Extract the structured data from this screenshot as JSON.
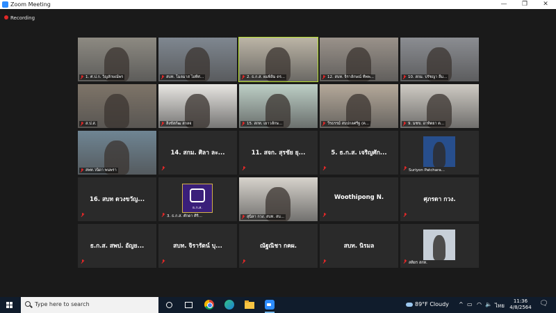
{
  "window": {
    "title": "Zoom Meeting"
  },
  "window_controls": {
    "minimize": "—",
    "maximize": "❐",
    "close": "✕"
  },
  "recording": {
    "label": "Recording"
  },
  "tiles": [
    {
      "name": "1. ศ.ป.ก. วิญลักษณ์พร",
      "kind": "video",
      "bg": "#8d8a82"
    },
    {
      "name": "สบท. โมลมาส ไอทีศ...",
      "kind": "video",
      "bg": "#7f8790"
    },
    {
      "name": "2. ธ.ก.ส. ผมพิลิม ดร...",
      "kind": "video",
      "bg": "#bcb5a6",
      "active": true
    },
    {
      "name": "12. สบท. จิราลักษณ์ ทีพพ...",
      "kind": "video",
      "bg": "#9a928a"
    },
    {
      "name": "10. สกม. ปรัชญา ลิ้ม...",
      "kind": "video",
      "bg": "#8b8d92"
    },
    {
      "name": "ส.ป.ส.",
      "kind": "video",
      "bg": "#7e7468"
    },
    {
      "name": "สิงขัสกัฒ สกลจ",
      "kind": "video",
      "bg": "#e8e6e2"
    },
    {
      "name": "15. สกท. เยาวลักษ...",
      "kind": "video",
      "bg": "#bdcfc6"
    },
    {
      "name": "วีรธรรม์ สบปกลศรีฐ (ค...",
      "kind": "video",
      "bg": "#b5a99a"
    },
    {
      "name": "9. มชข. อาทิตยา ต...",
      "kind": "video",
      "bg": "#cfcbc4"
    },
    {
      "name": "สพท.วนิดา พนพรา",
      "kind": "video",
      "bg": "#6f8593"
    },
    {
      "name": "14. สกม. ศิลา ละ...",
      "kind": "text"
    },
    {
      "name": "11. สจก. สุรชัย ยุ...",
      "kind": "text"
    },
    {
      "name": "5. ธ.ก.ส. เจริญศัก...",
      "kind": "text"
    },
    {
      "name": "Suriyon Patchara...",
      "kind": "avatar",
      "bg": "#274e8c"
    },
    {
      "name": "16. สบท ดวงขวัญ...",
      "kind": "text"
    },
    {
      "name": "3. ธ.ก.ส. ศักดา ศิริ...",
      "kind": "logo",
      "logo_text": "ธ.ก.ส."
    },
    {
      "name": "สุนิลา กวง. สบท. สบ...",
      "kind": "video",
      "bg": "#d7d3cc"
    },
    {
      "name": "Woothipong N.",
      "kind": "text"
    },
    {
      "name": "ศุภรดา กวง.",
      "kind": "text"
    },
    {
      "name": "ธ.ก.ส. สพป. อัญย...",
      "kind": "text"
    },
    {
      "name": "สบท. จิรารัตน์ บุ...",
      "kind": "text"
    },
    {
      "name": "ณัฐณิชา กคผ.",
      "kind": "text"
    },
    {
      "name": "สบท. นิรมล",
      "kind": "text"
    },
    {
      "name": "สติยร สกท.",
      "kind": "avatar",
      "bg": "#c7cfd8"
    }
  ],
  "taskbar": {
    "search_placeholder": "Type here to search",
    "weather": "89°F  Cloudy",
    "lang": "ไทย",
    "time": "11:36",
    "date": "4/8/2564"
  }
}
